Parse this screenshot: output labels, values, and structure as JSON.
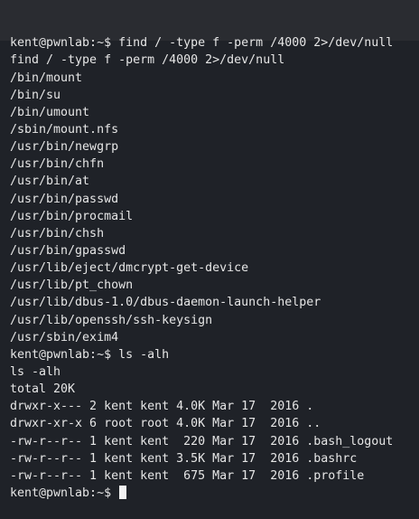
{
  "terminal": {
    "prompt": "kent@pwnlab:~$ ",
    "lines": [
      "kent@pwnlab:~$ find / -type f -perm /4000 2>/dev/null",
      "find / -type f -perm /4000 2>/dev/null",
      "/bin/mount",
      "/bin/su",
      "/bin/umount",
      "/sbin/mount.nfs",
      "/usr/bin/newgrp",
      "/usr/bin/chfn",
      "/usr/bin/at",
      "/usr/bin/passwd",
      "/usr/bin/procmail",
      "/usr/bin/chsh",
      "/usr/bin/gpasswd",
      "/usr/lib/eject/dmcrypt-get-device",
      "/usr/lib/pt_chown",
      "/usr/lib/dbus-1.0/dbus-daemon-launch-helper",
      "/usr/lib/openssh/ssh-keysign",
      "/usr/sbin/exim4",
      "kent@pwnlab:~$ ls -alh",
      "ls -alh",
      "total 20K",
      "drwxr-x--- 2 kent kent 4.0K Mar 17  2016 .",
      "drwxr-xr-x 6 root root 4.0K Mar 17  2016 ..",
      "-rw-r--r-- 1 kent kent  220 Mar 17  2016 .bash_logout",
      "-rw-r--r-- 1 kent kent 3.5K Mar 17  2016 .bashrc",
      "-rw-r--r-- 1 kent kent  675 Mar 17  2016 .profile"
    ]
  }
}
